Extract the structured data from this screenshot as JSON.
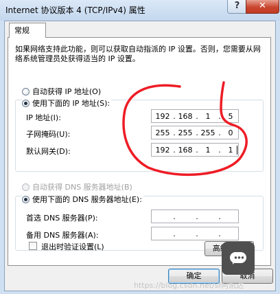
{
  "window": {
    "title": "Internet 协议版本 4 (TCP/IPv4) 属性",
    "help_glyph": "?",
    "close_glyph": "✕"
  },
  "tab": {
    "label": "常规"
  },
  "description": "如果网络支持此功能，则可以获取自动指派的 IP 设置。否则，您需要从网络系统管理员处获得适当的 IP 设置。",
  "ip_section": {
    "auto_label": "自动获得 IP 地址(O)",
    "manual_label": "使用下面的 IP 地址(S):",
    "selected": "manual",
    "fields": [
      {
        "label": "IP 地址(I):",
        "octets": [
          "192",
          "168",
          "1",
          "5"
        ]
      },
      {
        "label": "子网掩码(U):",
        "octets": [
          "255",
          "255",
          "255",
          "0"
        ]
      },
      {
        "label": "默认网关(D):",
        "octets": [
          "192",
          "168",
          "1",
          "1"
        ]
      }
    ]
  },
  "dns_section": {
    "auto_label": "自动获得 DNS 服务器地址(B)",
    "manual_label": "使用下面的 DNS 服务器地址(E):",
    "selected": "manual",
    "fields": [
      {
        "label": "首选 DNS 服务器(P):",
        "octets": [
          "",
          "",
          "",
          ""
        ]
      },
      {
        "label": "备用 DNS 服务器(A):",
        "octets": [
          "",
          "",
          "",
          ""
        ]
      }
    ]
  },
  "validate_on_exit": {
    "label": "退出时验证设置(L)",
    "checked": false
  },
  "buttons": {
    "advanced": "高级(V)...",
    "ok": "确定",
    "cancel": "取消"
  },
  "watermark": "https://blog.csdn.net/sf阿凯达"
}
